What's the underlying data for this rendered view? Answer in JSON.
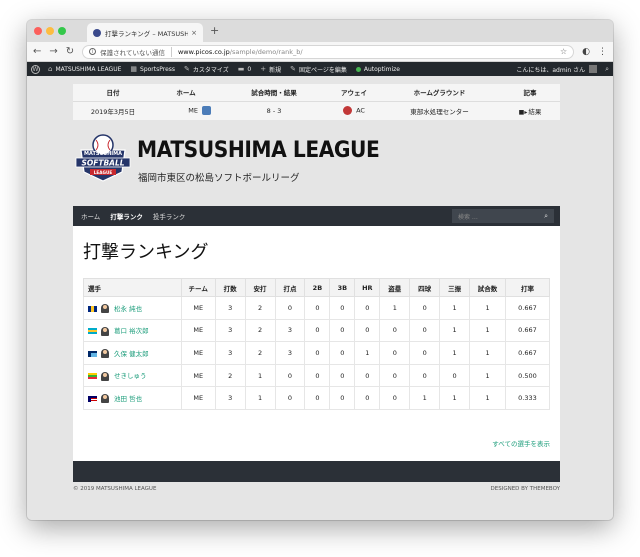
{
  "browser": {
    "tab_title": "打撃ランキング – MATSUSHIMA LEAGUE",
    "tab_close": "×",
    "new_tab": "+",
    "security_text": "保護されていない通信",
    "url_host": "www.picos.co.jp",
    "url_path": "/sample/demo/rank_b/"
  },
  "adminbar": {
    "site": "MATSUSHIMA LEAGUE",
    "sportspress": "SportsPress",
    "customize": "カスタマイズ",
    "comments_count": "0",
    "new": "新規",
    "edit": "固定ページを編集",
    "autoptimize": "Autoptimize",
    "greeting": "こんにちは、admin さん"
  },
  "event": {
    "headers": [
      "日付",
      "ホーム",
      "試合時間・結果",
      "アウェイ",
      "ホームグラウンド",
      "記事"
    ],
    "row": {
      "date": "2019年3月5日",
      "home": "ME",
      "result": "8 - 3",
      "away": "AC",
      "venue": "東部水処理センター",
      "article": "結果"
    }
  },
  "header": {
    "title": "MATSUSHIMA LEAGUE",
    "description": "福岡市東区の松島ソフトボールリーグ",
    "logo_top": "MATSUSHIMA",
    "logo_main": "SOFTBALL",
    "logo_bottom": "LEAGUE"
  },
  "nav": {
    "items": [
      {
        "label": "ホーム",
        "active": false
      },
      {
        "label": "打撃ランク",
        "active": true
      },
      {
        "label": "投手ランク",
        "active": false
      }
    ],
    "search_placeholder": "検索 …"
  },
  "content": {
    "title": "打撃ランキング",
    "table": {
      "headers": [
        "選手",
        "チーム",
        "打数",
        "安打",
        "打点",
        "2B",
        "3B",
        "HR",
        "盗塁",
        "四球",
        "三振",
        "試合数",
        "打率"
      ],
      "rows": [
        {
          "name": "松永 純也",
          "team": "ME",
          "ab": "3",
          "h": "2",
          "rbi": "0",
          "b2": "0",
          "b3": "0",
          "hr": "0",
          "sb": "1",
          "bb": "0",
          "so": "1",
          "g": "1",
          "avg": "0.667",
          "flag": "barbados"
        },
        {
          "name": "葛口 裕次郎",
          "team": "ME",
          "ab": "3",
          "h": "2",
          "rbi": "3",
          "b2": "0",
          "b3": "0",
          "hr": "0",
          "sb": "0",
          "bb": "0",
          "so": "1",
          "g": "1",
          "avg": "0.667",
          "flag": "bahamas"
        },
        {
          "name": "久保 健太郎",
          "team": "ME",
          "ab": "3",
          "h": "2",
          "rbi": "3",
          "b2": "0",
          "b3": "0",
          "hr": "1",
          "sb": "0",
          "bb": "0",
          "so": "1",
          "g": "1",
          "avg": "0.667",
          "flag": "fiji"
        },
        {
          "name": "せきしゅう",
          "team": "ME",
          "ab": "2",
          "h": "1",
          "rbi": "0",
          "b2": "0",
          "b3": "0",
          "hr": "0",
          "sb": "0",
          "bb": "0",
          "so": "0",
          "g": "1",
          "avg": "0.500",
          "flag": "myanmar"
        },
        {
          "name": "池田 哲也",
          "team": "ME",
          "ab": "3",
          "h": "1",
          "rbi": "0",
          "b2": "0",
          "b3": "0",
          "hr": "0",
          "sb": "0",
          "bb": "1",
          "so": "1",
          "g": "1",
          "avg": "0.333",
          "flag": "malaysia"
        }
      ]
    },
    "view_all": "すべての選手を表示"
  },
  "footer": {
    "copyright": "© 2019 MATSUSHIMA LEAGUE",
    "credit": "DESIGNED BY THEMEBOY"
  },
  "colors": {
    "link": "#1a9c7a",
    "nav_bg": "#2b3037",
    "adminbar_bg": "#23282d",
    "logo_navy": "#253569",
    "logo_red": "#c8282e"
  }
}
